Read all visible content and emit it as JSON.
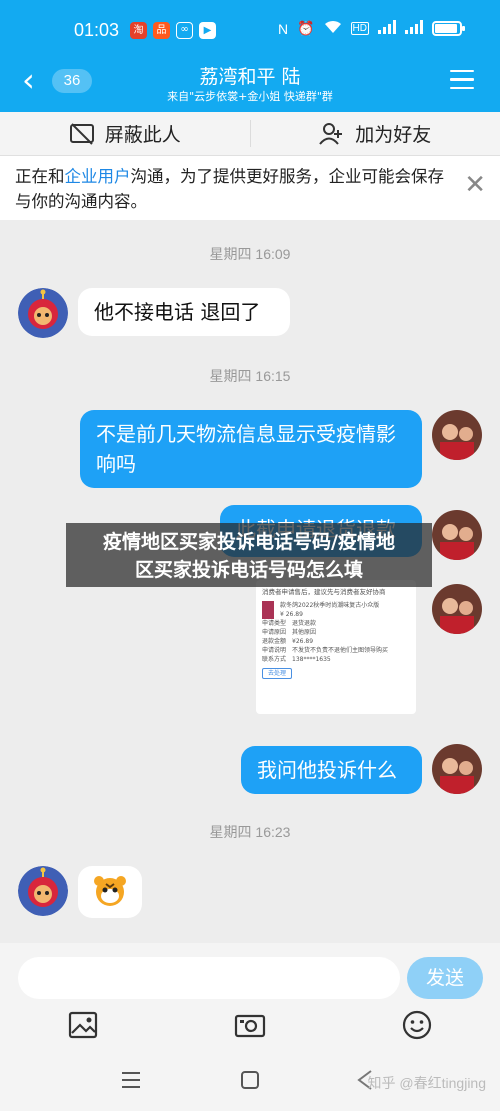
{
  "status": {
    "time": "01:03",
    "app_icons": [
      "app-icon-1",
      "app-icon-2",
      "app-icon-3",
      "app-icon-4"
    ],
    "battery_level": 0.85
  },
  "header": {
    "back_icon": "chevron-left-icon",
    "unread_count": "36",
    "title": "荔湾和平  陆",
    "subtitle": "来自\"云步依裳+金小姐 快递群\"群",
    "menu_icon": "hamburger-menu-icon"
  },
  "actions": {
    "block_label": "屏蔽此人",
    "add_friend_label": "加为好友"
  },
  "notice": {
    "text_before": "正在和",
    "link": "企业用户",
    "text_after": "沟通，为了提供更好服务，企业可能会保存与你的沟通内容。",
    "close_icon": "close-icon"
  },
  "messages": {
    "ts1": "星期四 16:09",
    "m1": "他不接电话 退回了",
    "ts2": "星期四 16:15",
    "m2": "不是前几天物流信息显示受疫情影响吗",
    "m3": "此截申请退货退款",
    "card": {
      "title": "消费者申请售后，建议先与消费者友好协商",
      "product": "款冬鸽2022秋季时尚潮味复古小众版",
      "price": "¥ 26.89",
      "r1_label": "申请类型",
      "r1_value": "退货退款",
      "r2_label": "申请原因",
      "r2_value": "其他原因",
      "r3_label": "退款金额",
      "r3_value": "¥26.89",
      "r4_label": "申请说明",
      "r4_value": "不发货不负责不退他们主图领导购买",
      "r5_label": "联系方式",
      "r5_value": "138****1635",
      "button": "去处理"
    },
    "m4": "我问他投诉什么",
    "ts3": "星期四 16:23"
  },
  "watermark": {
    "line1": "疫情地区买家投诉电话号码/疫情地",
    "line2": "区买家投诉电话号码怎么填"
  },
  "input": {
    "placeholder": "",
    "send_label": "发送",
    "tools": [
      "image-icon",
      "camera-icon",
      "emoji-icon"
    ]
  },
  "sysnav": {
    "credit": "知乎 @春红tingjing"
  },
  "colors": {
    "primary_blue": "#13aaf1",
    "bubble_out": "#1ea1f6",
    "send_disabled": "#8fd0f7"
  }
}
